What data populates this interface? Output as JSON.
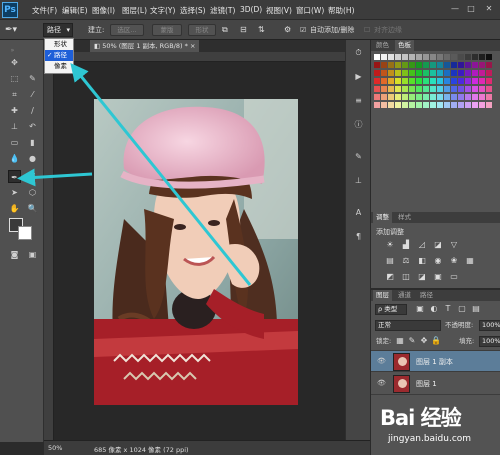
{
  "app": {
    "logo": "Ps"
  },
  "menu": [
    "文件(F)",
    "编辑(E)",
    "图像(I)",
    "图层(L)",
    "文字(Y)",
    "选择(S)",
    "滤镜(T)",
    "3D(D)",
    "视图(V)",
    "窗口(W)",
    "帮助(H)"
  ],
  "window_controls": [
    "—",
    "□",
    "✕"
  ],
  "options": {
    "mode_value": "路径",
    "build_label": "建立:",
    "selection_btn": "选区...",
    "mask_btn": "蒙版",
    "shape_btn": "形状",
    "auto_add_label": "自动添加/删除",
    "auto_add_checked": true,
    "align_edges_label": "对齐边缘"
  },
  "mode_dropdown": {
    "items": [
      "形状",
      "路径",
      "像素"
    ],
    "selected_index": 1
  },
  "document": {
    "tab_title": "50% (图层 1 副本, RGB/8) *",
    "zoom": "50%",
    "info": "685 像素 x 1024 像素 (72 ppi)"
  },
  "panels": {
    "color_tabs": [
      "颜色",
      "色板"
    ],
    "adjust_tabs": [
      "调整",
      "样式"
    ],
    "adjust_title": "添加调整",
    "layers_tabs": [
      "图层",
      "通道",
      "路径"
    ],
    "kind_label": "ρ 类型",
    "blend_mode": "正常",
    "opacity_label": "不透明度:",
    "opacity_value": "100%",
    "lock_label": "锁定:",
    "fill_label": "填充:",
    "fill_value": "100%",
    "layers": [
      {
        "name": "图层 1 副本",
        "selected": true
      },
      {
        "name": "图层 1",
        "selected": false
      }
    ]
  },
  "watermark": {
    "logo": "Bai 经验",
    "url": "jingyan.baidu.com"
  },
  "colors": {
    "annotation_arrow": "#2ec7d3",
    "selection_blue": "#1e5fd8"
  }
}
